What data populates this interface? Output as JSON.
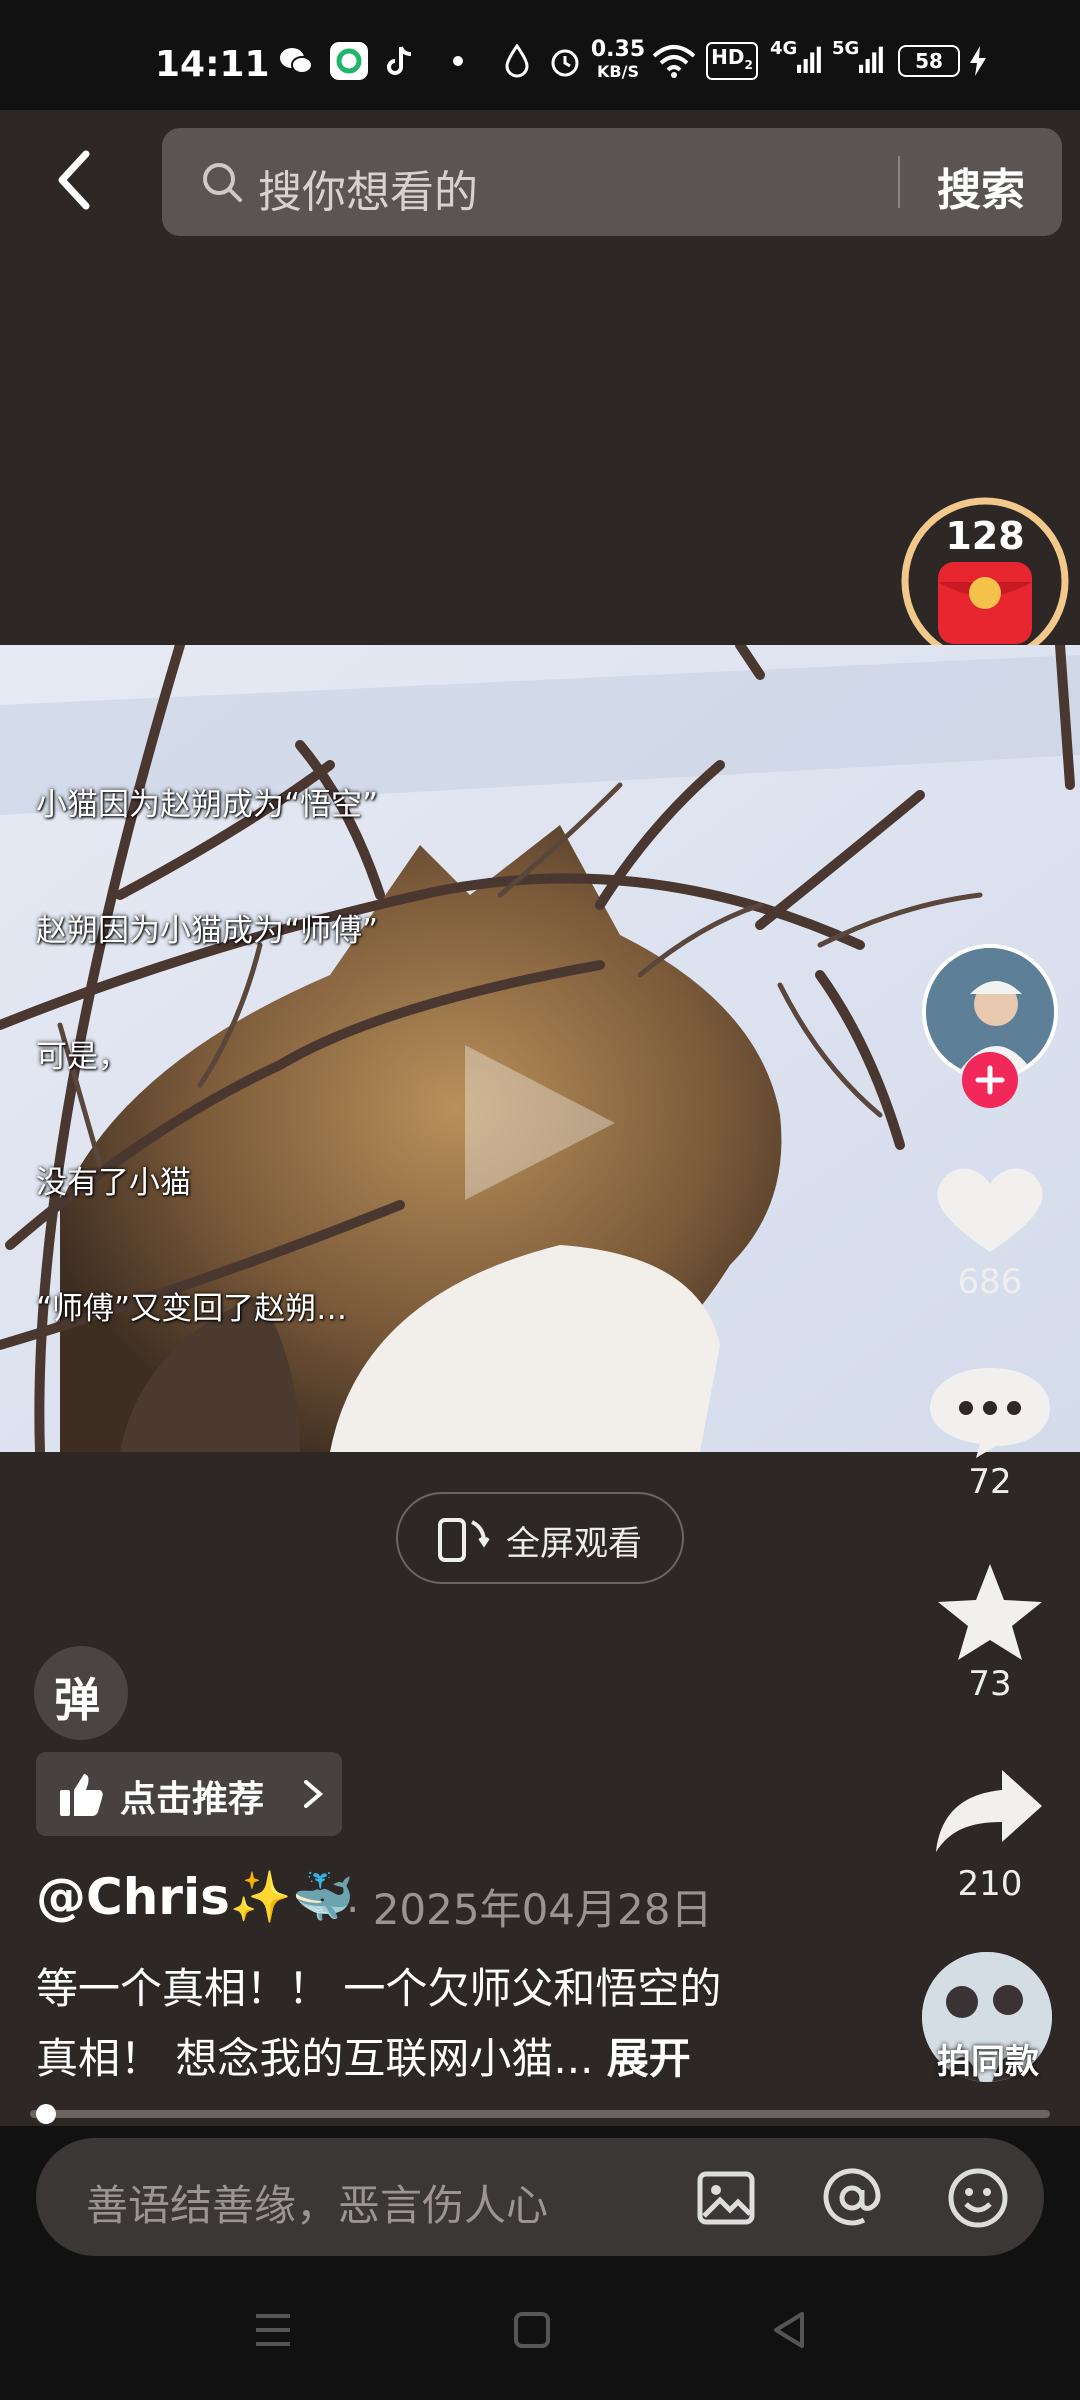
{
  "status_bar": {
    "time": "14:11",
    "net_speed_value": "0.35",
    "net_speed_unit": "KB/S",
    "hd": "HD",
    "hd_sub": "2",
    "sig1": "4G",
    "sig2": "5G",
    "battery": "58"
  },
  "search": {
    "placeholder": "搜你想看的",
    "button_label": "搜索"
  },
  "red_packet": {
    "count": "128"
  },
  "video": {
    "overlay_lines": [
      "小猫因为赵朔成为“悟空”",
      "赵朔因为小猫成为“师傅”",
      "可是，",
      "没有了小猫",
      "“师傅”又变回了赵朔…"
    ]
  },
  "actions": {
    "likes": "686",
    "comments": "72",
    "favorites": "73",
    "shares": "210",
    "same_style_label": "拍同款"
  },
  "fullscreen_label": "全屏观看",
  "danmu_label": "弹",
  "recommend_label": "点击推荐",
  "post": {
    "author": "@Chris✨🐳",
    "date": "· 2025年04月28日",
    "description_line1": "等一个真相！！ 一个欠师父和悟空的",
    "description_line2": "真相！ 想念我的互联网小猫...",
    "expand_label": "展开"
  },
  "progress_fraction": 0.01,
  "comment_input": {
    "placeholder": "善语结善缘，恶言伤人心"
  },
  "colors": {
    "accent_red": "#f2285a",
    "gold": "#f3c98b",
    "bg": "#2d2726"
  }
}
